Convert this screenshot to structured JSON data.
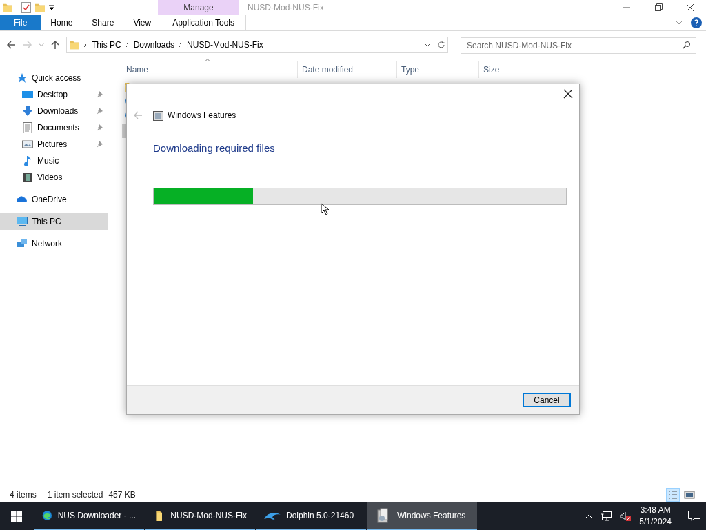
{
  "explorer": {
    "title": "NUSD-Mod-NUS-Fix",
    "context_group": "Manage",
    "ribbon_tabs": [
      {
        "label": "File",
        "kind": "file",
        "selected": false
      },
      {
        "label": "Home",
        "kind": "tab",
        "selected": false
      },
      {
        "label": "Share",
        "kind": "tab",
        "selected": false
      },
      {
        "label": "View",
        "kind": "tab",
        "selected": false
      },
      {
        "label": "Application Tools",
        "kind": "context",
        "selected": false
      }
    ],
    "breadcrumbs": [
      "This PC",
      "Downloads",
      "NUSD-Mod-NUS-Fix"
    ],
    "search": {
      "placeholder": "Search NUSD-Mod-NUS-Fix"
    },
    "navigation": [
      {
        "label": "Quick access",
        "kind": "star",
        "selected": false,
        "children": [
          {
            "label": "Desktop",
            "kind": "desktop",
            "pinned": true,
            "selected": false
          },
          {
            "label": "Downloads",
            "kind": "download",
            "pinned": true,
            "selected": false
          },
          {
            "label": "Documents",
            "kind": "document",
            "pinned": true,
            "selected": false
          },
          {
            "label": "Pictures",
            "kind": "pictures",
            "pinned": true,
            "selected": false
          },
          {
            "label": "Music",
            "kind": "music",
            "pinned": false,
            "selected": false
          },
          {
            "label": "Videos",
            "kind": "videos",
            "pinned": false,
            "selected": false
          }
        ]
      },
      {
        "label": "OneDrive",
        "kind": "cloud",
        "selected": false
      },
      {
        "label": "This PC",
        "kind": "pc",
        "selected": true
      },
      {
        "label": "Network",
        "kind": "network",
        "selected": false
      }
    ],
    "columns": [
      "Name",
      "Date modified",
      "Type",
      "Size"
    ],
    "status": {
      "count": "4 items",
      "selection": "1 item selected",
      "size": "457 KB"
    }
  },
  "dialog": {
    "title": "Windows Features",
    "heading": "Downloading required files",
    "progress": {
      "level": 0.24
    },
    "button": "Cancel"
  },
  "taskbar": {
    "items": [
      {
        "label": "NUS Downloader - ...",
        "kind": "browser",
        "active": false
      },
      {
        "label": "NUSD-Mod-NUS-Fix",
        "kind": "folder",
        "active": false
      },
      {
        "label": "Dolphin 5.0-21460",
        "kind": "dolphin",
        "active": false
      },
      {
        "label": "Windows Features",
        "kind": "features",
        "active": true
      }
    ],
    "time": "3:48 AM",
    "date": "5/1/2024"
  }
}
